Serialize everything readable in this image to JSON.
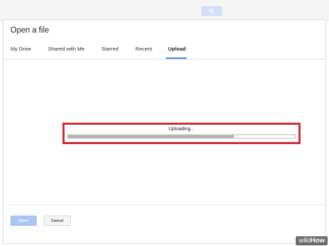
{
  "header": {
    "search_icon": "search-icon"
  },
  "dialog": {
    "title": "Open a file",
    "tabs": [
      {
        "label": "My Drive"
      },
      {
        "label": "Shared with Me"
      },
      {
        "label": "Starred"
      },
      {
        "label": "Recent"
      },
      {
        "label": "Upload",
        "active": true
      }
    ],
    "upload": {
      "status_text": "Uploading...",
      "progress_fraction": 0.73
    },
    "buttons": {
      "open": "Open",
      "cancel": "Cancel"
    }
  },
  "watermark": {
    "part1": "wiki",
    "part2": "How"
  },
  "colors": {
    "accent": "#4285f4",
    "highlight_border": "#d12a35",
    "open_button": "#a9c6f3"
  }
}
